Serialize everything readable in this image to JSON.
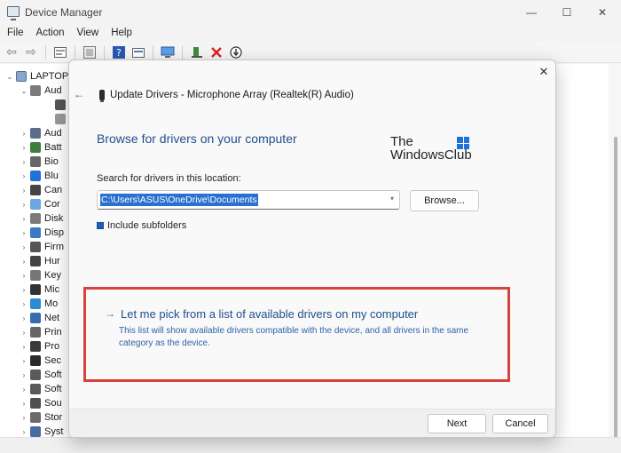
{
  "window": {
    "title": "Device Manager",
    "minimize_glyph": "—",
    "maximize_glyph": "☐",
    "close_glyph": "✕"
  },
  "menu": {
    "items": [
      "File",
      "Action",
      "View",
      "Help"
    ]
  },
  "toolbar": {
    "back_glyph": "⇦",
    "forward_glyph": "⇨",
    "icons": [
      "properties-icon",
      "list-view-icon",
      "help-icon",
      "resources-icon",
      "scan-hardware-icon",
      "update-driver-icon",
      "uninstall-icon",
      "disable-icon"
    ]
  },
  "tree": {
    "root_label": "LAPTOP",
    "rows": [
      "Aud",
      "",
      "",
      "Aud",
      "Batt",
      "Bio",
      "Blu",
      "Can",
      "Cor",
      "Disk",
      "Disp",
      "Firm",
      "Hur",
      "Key",
      "Mic",
      "Mo",
      "Net",
      "Prin",
      "Pro",
      "Sec",
      "Soft",
      "Soft",
      "Sou",
      "Stor",
      "Syst"
    ]
  },
  "dialog": {
    "header_title": "Update Drivers - Microphone Array (Realtek(R) Audio)",
    "heading": "Browse for drivers on your computer",
    "watermark_line1": "The",
    "watermark_line2": "WindowsClub",
    "search_label": "Search for drivers in this location:",
    "search_path": "C:\\Users\\ASUS\\OneDrive\\Documents",
    "browse_label": "Browse...",
    "include_subfolders_label": "Include subfolders",
    "pick_link_label": "Let me pick from a list of available drivers on my computer",
    "pick_description": "This list will show available drivers compatible with the device, and all drivers in the same category as the device.",
    "next_label": "Next",
    "cancel_label": "Cancel"
  },
  "colors": {
    "accent": "#1f4e8c",
    "highlight_border": "#d9413a",
    "selection": "#2a70d0"
  }
}
